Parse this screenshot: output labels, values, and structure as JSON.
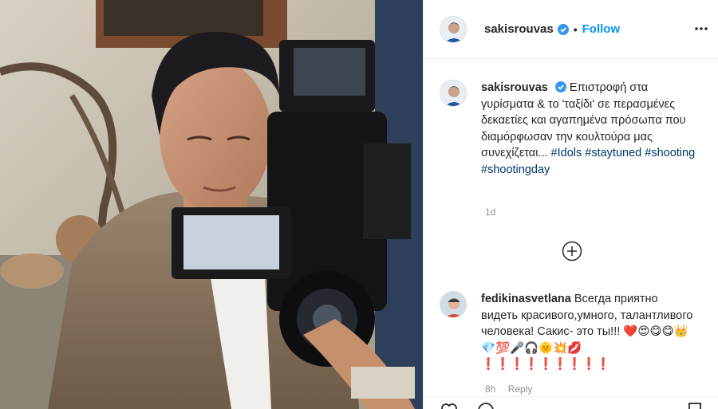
{
  "post": {
    "username": "sakisrouvas",
    "follow_label": "Follow",
    "separator": "•",
    "verified_icon": "verified-badge-icon",
    "more_icon": "more-options-icon"
  },
  "caption": {
    "username": "sakisrouvas",
    "text": "Επιστροφή στα γυρίσματα & το 'ταξίδι' σε περασμένες δεκαετίες και αγαπημένα πρόσωπα που διαμόρφωσαν την κουλτούρα μας συνεχίζεται...",
    "hashtags": [
      "#Idols",
      "#staytuned",
      "#shooting",
      "#shootingday"
    ],
    "time": "1d"
  },
  "load_more_icon": "plus-circle-icon",
  "comment": {
    "username": "fedikinasvetlana",
    "text": "Всегда приятно видеть красивого,умного, талантливого человека! Сакис- это ты!!!",
    "emojis": "❤️😍😋😋👑💎💯🎤🎧🌞💥💋❗❗❗❗❗❗❗❗❗",
    "time": "8h",
    "reply_label": "Reply"
  },
  "colors": {
    "accent": "#0095f6",
    "hashtag": "#00376b",
    "muted": "#8e8e8e"
  }
}
